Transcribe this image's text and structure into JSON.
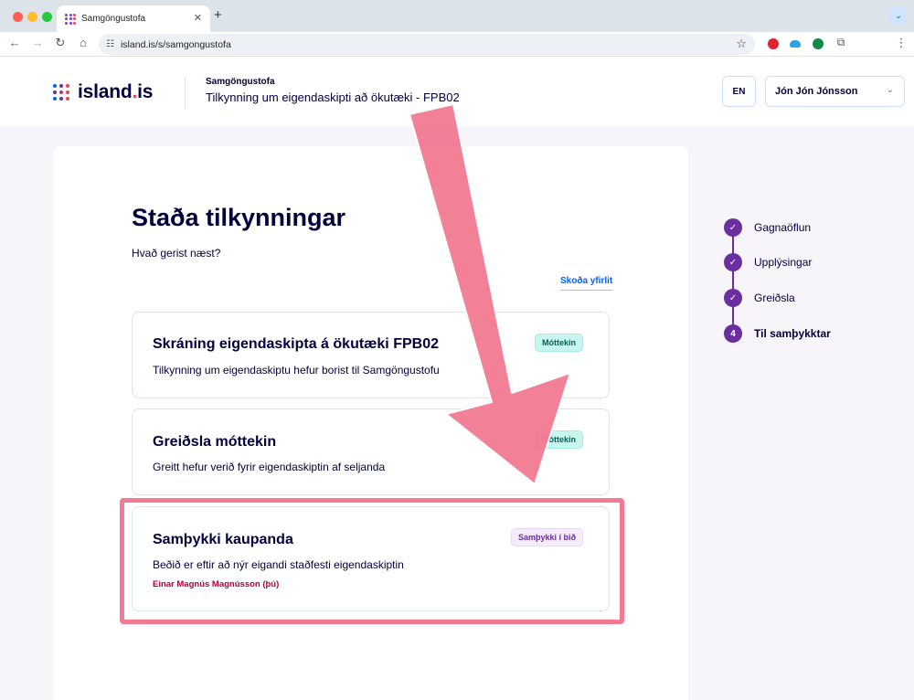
{
  "browser": {
    "tab_title": "Samgöngustofa",
    "url": "island.is/s/samgongustofa",
    "tab_close": "✕",
    "new_tab": "+",
    "tab_menu": "⌄"
  },
  "header": {
    "logo_name": "island",
    "logo_dot": ".",
    "logo_tld": "is",
    "org_name": "Samgöngustofa",
    "app_title": "Tilkynning um eigendaskipti að ökutæki - FPB02",
    "language_button": "EN",
    "user_name": "Jón Jón Jónsson"
  },
  "main": {
    "title": "Staða tilkynningar",
    "subtitle": "Hvað gerist næst?",
    "overview_link": "Skoða yfirlit",
    "cards": [
      {
        "title": "Skráning eigendaskipta á ökutæki FPB02",
        "text": "Tilkynning um eigendaskiptu hefur borist til Samgöngustofu",
        "tag": "Móttekin"
      },
      {
        "title": "Greiðsla móttekin",
        "text": "Greitt hefur verið fyrir eigendaskiptin af seljanda",
        "tag": "Móttekin"
      },
      {
        "title": "Samþykki kaupanda",
        "text": "Beðið er eftir að nýr eigandi staðfesti eigendaskiptin",
        "extra": "Einar Magnús Magnússon (þú)",
        "tag": "Samþykki í bið"
      }
    ]
  },
  "steps": [
    {
      "label": "Gagnaöflun",
      "marker": "✓"
    },
    {
      "label": "Upplýsingar",
      "marker": "✓"
    },
    {
      "label": "Greiðsla",
      "marker": "✓"
    },
    {
      "label": "Til samþykktar",
      "marker": "4"
    }
  ],
  "colors": {
    "primary_text": "#00003c",
    "step_purple": "#6a2ea0",
    "tag_ok_bg": "#c9f5ef",
    "tag_wait_bg": "#f4ecfa",
    "annotation_pink": "#f27b93",
    "link_blue": "#0061ff"
  },
  "icons": {
    "back": "arrow-left-icon",
    "forward": "arrow-right-icon",
    "reload": "reload-icon",
    "home": "home-icon",
    "bookmark": "star-icon",
    "user_menu": "chevron-down-icon"
  }
}
